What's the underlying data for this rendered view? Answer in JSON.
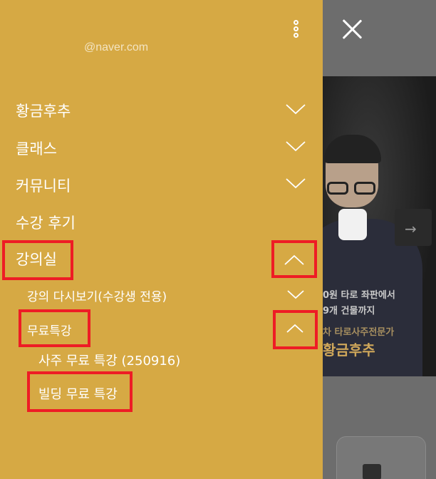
{
  "drawer": {
    "email": "@naver.com",
    "menu": [
      {
        "label": "황금후추",
        "expanded": false
      },
      {
        "label": "클래스",
        "expanded": false
      },
      {
        "label": "커뮤니티",
        "expanded": false
      },
      {
        "label": "수강 후기"
      },
      {
        "label": "강의실",
        "expanded": true,
        "children": [
          {
            "label": "강의 다시보기(수강생 전용)",
            "expanded": false
          },
          {
            "label": "무료특강",
            "expanded": true,
            "children": [
              {
                "label": "사주 무료 특강 (250916)"
              },
              {
                "label": "빌딩 무료 특강"
              }
            ]
          }
        ]
      }
    ]
  },
  "background": {
    "banner": {
      "line1": "0원 타로 좌판에서",
      "line2": "9개 건물까지",
      "line3": "차 타로사주전문가",
      "name": "황금후추"
    }
  },
  "colors": {
    "drawer_bg": "#d6a944",
    "highlight": "#ee1c25",
    "overlay": "#6d6d6d"
  }
}
